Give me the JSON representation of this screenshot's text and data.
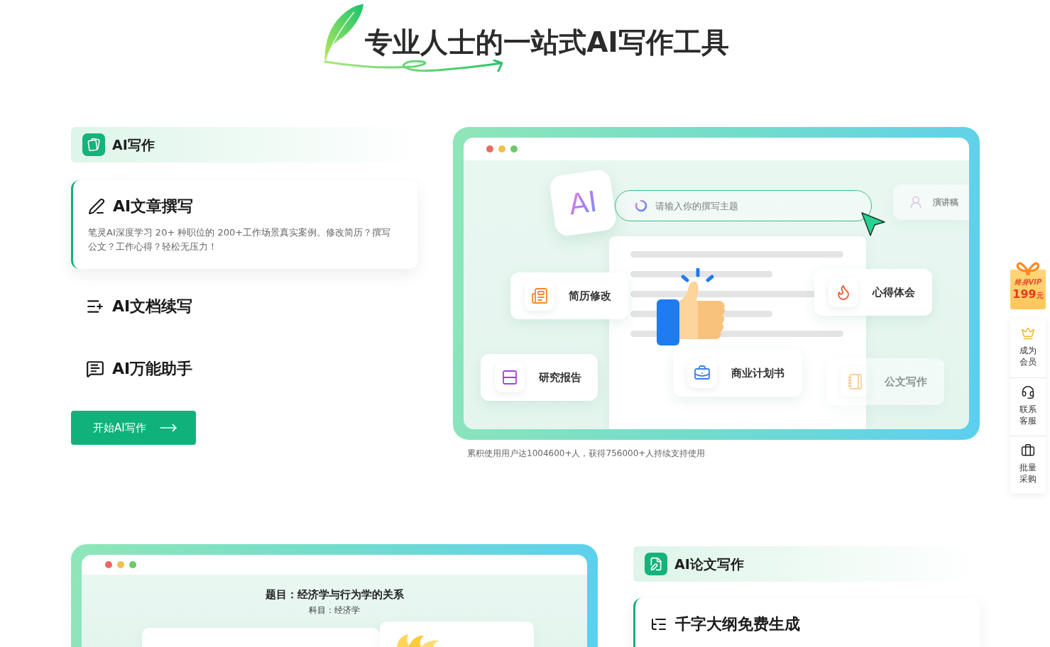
{
  "header": {
    "title": "专业人士的一站式AI写作工具"
  },
  "writing": {
    "category": "AI写作",
    "features": [
      {
        "title": "AI文章撰写",
        "description": "笔灵AI深度学习 20+ 种职位的 200+工作场景真实案例。修改简历？撰写公文？工作心得？轻松无压力！",
        "selected": true
      },
      {
        "title": "AI文档续写",
        "selected": false
      },
      {
        "title": "AI万能助手",
        "selected": false
      }
    ],
    "start_button": "开始AI写作"
  },
  "illustration": {
    "ai_tile": "AI",
    "search": {
      "placeholder": "请输入你的撰写主题"
    },
    "chips": [
      {
        "label": "演讲稿",
        "faded": true
      },
      {
        "label": "简历修改",
        "faded": false
      },
      {
        "label": "心得体会",
        "faded": false
      },
      {
        "label": "研究报告",
        "faded": false
      },
      {
        "label": "商业计划书",
        "faded": false
      },
      {
        "label": "公文写作",
        "faded": true
      }
    ],
    "caption": "累积使用用户达1004600+人，获得756000+人持续支持使用"
  },
  "sidebar": {
    "vip": {
      "label": "终身VIP",
      "price": "199",
      "unit": "元"
    },
    "items": [
      {
        "label": "成为会员"
      },
      {
        "label": "联系客服"
      },
      {
        "label": "批量采购"
      }
    ]
  },
  "paper": {
    "preview": {
      "title": "题目：经济学与行为学的关系",
      "subject": "科目：经济学"
    },
    "category": "AI论文写作",
    "features": [
      {
        "title": "千字大纲免费生成",
        "selected": true
      }
    ]
  }
}
